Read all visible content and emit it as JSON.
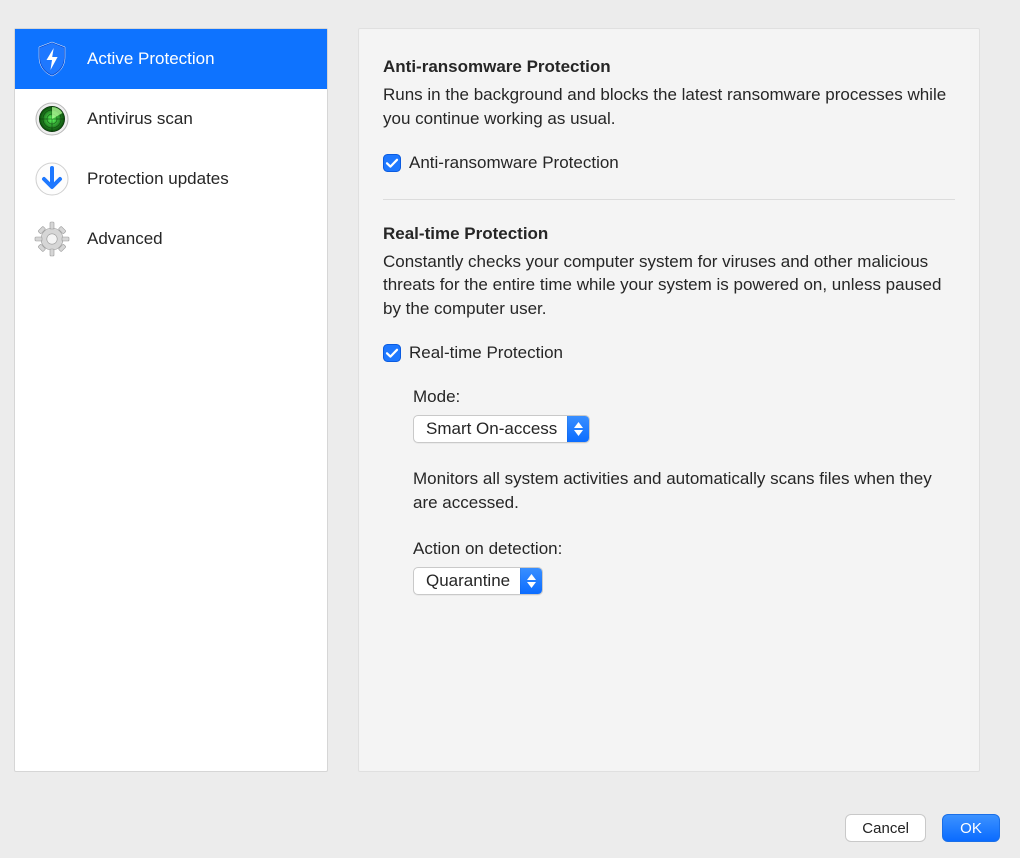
{
  "sidebar": {
    "items": [
      {
        "label": "Active Protection"
      },
      {
        "label": "Antivirus scan"
      },
      {
        "label": "Protection updates"
      },
      {
        "label": "Advanced"
      }
    ]
  },
  "anti_ransomware": {
    "title": "Anti-ransomware Protection",
    "description": "Runs in the background and blocks the latest ransomware processes while you continue working as usual.",
    "checkbox_label": "Anti-ransomware Protection",
    "checked": true
  },
  "realtime": {
    "title": "Real-time Protection",
    "description": "Constantly checks your computer system for viruses and other malicious threats for the entire time while your system is powered on, unless paused by the computer user.",
    "checkbox_label": "Real-time Protection",
    "checked": true,
    "mode_label": "Mode:",
    "mode_value": "Smart On-access",
    "mode_note": "Monitors all system activities and automatically scans files when they are accessed.",
    "action_label": "Action on detection:",
    "action_value": "Quarantine"
  },
  "footer": {
    "cancel": "Cancel",
    "ok": "OK"
  }
}
